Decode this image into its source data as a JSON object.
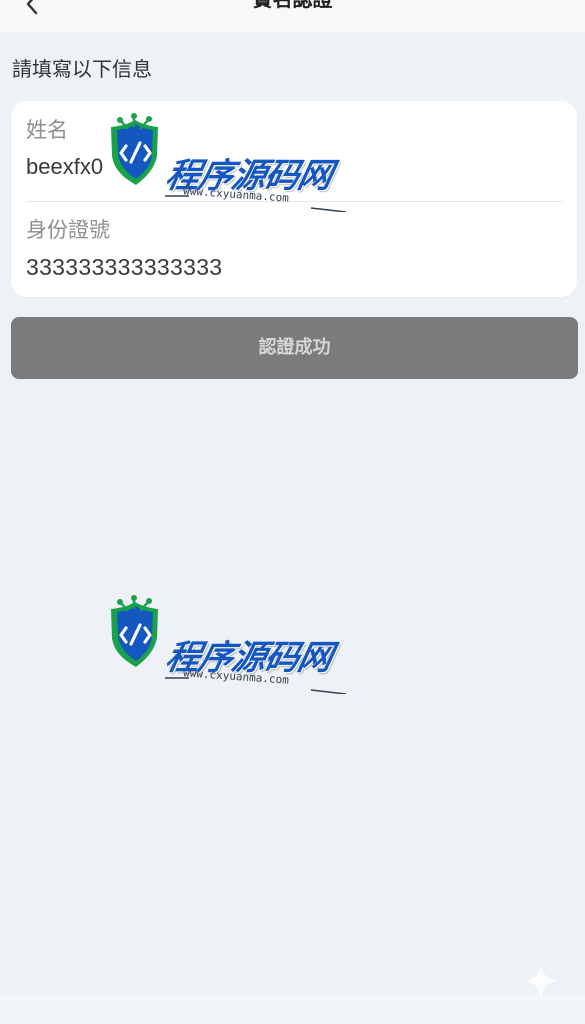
{
  "header": {
    "title": "實名認證",
    "back_icon": "chevron-left-icon"
  },
  "form": {
    "section_label": "請填寫以下信息",
    "name_field": {
      "label": "姓名",
      "value": "beexfx0"
    },
    "id_field": {
      "label": "身份證號",
      "value": "333333333333333"
    }
  },
  "actions": {
    "submit_label": "認證成功"
  },
  "watermark": {
    "brand": "程序源码网",
    "url": "www.cxyuanma.com",
    "icon": "code-shield-logo-icon"
  },
  "colors": {
    "background": "#eef2f6",
    "card": "#ffffff",
    "button": "#7b7b7b",
    "brand_blue": "#1557c0",
    "brand_green": "#1aa24a"
  }
}
